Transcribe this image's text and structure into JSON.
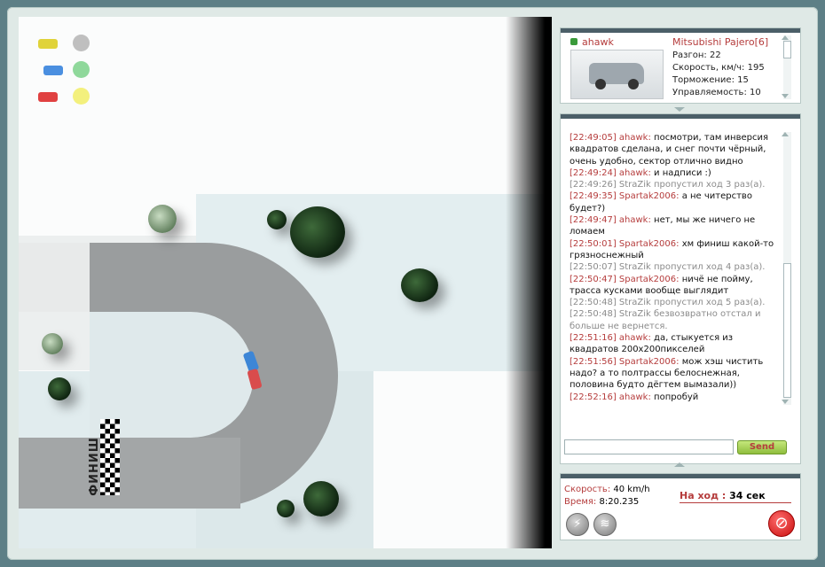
{
  "colors": {
    "accent_red": "#b53c3c",
    "panel_bar": "#4b5f68",
    "send_button": "#a5cf55",
    "system_text": "#8b8b8b"
  },
  "game": {
    "finish_label": "ФИНИШ",
    "lights": [
      {
        "car_color": "#e0d33a",
        "light_color": "#bfbfbf"
      },
      {
        "car_color": "#4a8fe0",
        "light_color": "#8fd89b"
      },
      {
        "car_color": "#e04141",
        "light_color": "#f3f07d"
      }
    ]
  },
  "car_info": {
    "username": "ahawk",
    "model": "Mitsubishi Pajero[6]",
    "stats": [
      {
        "label": "Разгон:",
        "value": "22"
      },
      {
        "label": "Скорость, км/ч:",
        "value": "195"
      },
      {
        "label": "Торможение:",
        "value": "15"
      },
      {
        "label": "Управляемость:",
        "value": "10"
      }
    ]
  },
  "chat": {
    "messages": [
      {
        "time": "[22:49:05]",
        "nick": "ahawk:",
        "text": "посмотри, там инверсия квадратов сделана, и снег почти чёрный, очень удобно, сектор отлично видно",
        "type": "user"
      },
      {
        "time": "[22:49:24]",
        "nick": "ahawk:",
        "text": "и надписи :)",
        "type": "user"
      },
      {
        "time": "[22:49:26]",
        "nick": "",
        "text": "StraZik пропустил ход 3 раз(а).",
        "type": "system"
      },
      {
        "time": "[22:49:35]",
        "nick": "Spartak2006:",
        "text": "а не читерство будет?)",
        "type": "user"
      },
      {
        "time": "[22:49:47]",
        "nick": "ahawk:",
        "text": "нет, мы же ничего не ломаем",
        "type": "user"
      },
      {
        "time": "[22:50:01]",
        "nick": "Spartak2006:",
        "text": "хм финиш какой-то грязноснежный",
        "type": "user"
      },
      {
        "time": "[22:50:07]",
        "nick": "",
        "text": "StraZik пропустил ход 4 раз(а).",
        "type": "system"
      },
      {
        "time": "[22:50:47]",
        "nick": "Spartak2006:",
        "text": "ничё не пойму, трасса кусками вообще выглядит",
        "type": "user"
      },
      {
        "time": "[22:50:48]",
        "nick": "",
        "text": "StraZik пропустил ход 5 раз(а).",
        "type": "system"
      },
      {
        "time": "[22:50:48]",
        "nick": "",
        "text": "StraZik безвозвратно отстал и больше не вернется.",
        "type": "system"
      },
      {
        "time": "[22:51:16]",
        "nick": "ahawk:",
        "text": "да, стыкуется из квадратов 200x200пикселей",
        "type": "user"
      },
      {
        "time": "[22:51:56]",
        "nick": "Spartak2006:",
        "text": "мож хэш чистить надо? а то полтрассы белоснежная, половина будто дёгтем вымазали))",
        "type": "user"
      },
      {
        "time": "[22:52:16]",
        "nick": "ahawk:",
        "text": "попробуй",
        "type": "user"
      }
    ],
    "input_value": "",
    "send_label": "Send"
  },
  "status": {
    "speed_label": "Скорость:",
    "speed_value": "40 km/h",
    "time_label": "Время:",
    "time_value": "8:20.235",
    "turn_label": "На ход :",
    "turn_value": "34 сек"
  }
}
